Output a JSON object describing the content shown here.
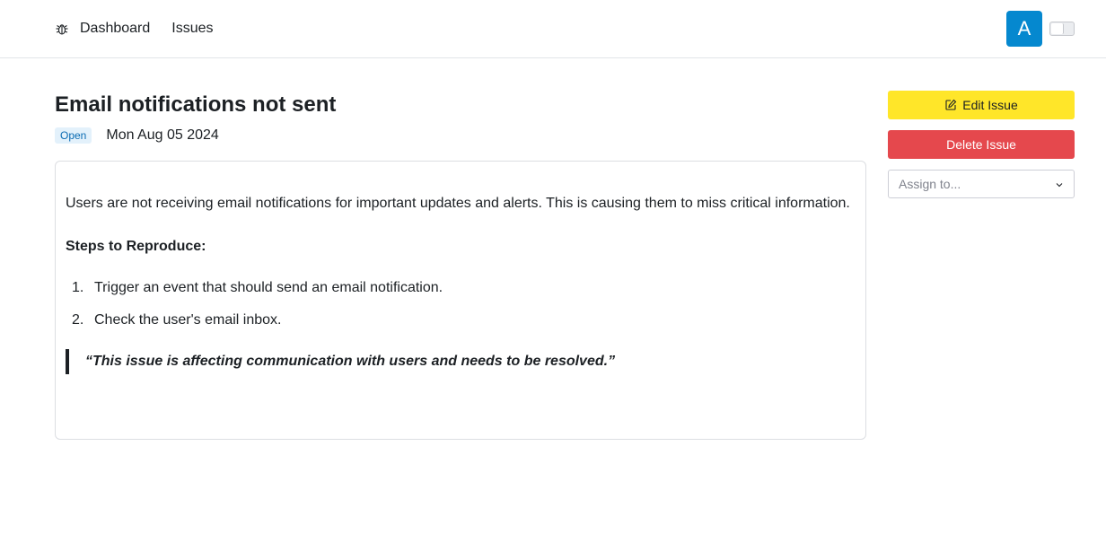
{
  "nav": {
    "logo_icon": "bug-icon",
    "links": [
      "Dashboard",
      "Issues"
    ]
  },
  "user": {
    "avatar_initial": "A"
  },
  "issue": {
    "title": "Email notifications not sent",
    "status": "Open",
    "date": "Mon Aug 05 2024",
    "description": "Users are not receiving email notifications for important updates and alerts. This is causing them to miss critical information.",
    "steps_heading": "Steps to Reproduce:",
    "steps": [
      {
        "num": "1.",
        "text": "Trigger an event that should send an email notification."
      },
      {
        "num": "2.",
        "text": "Check the user's email inbox."
      }
    ],
    "quote": "“This issue is affecting communication with users and needs to be resolved.”"
  },
  "actions": {
    "edit_label": "Edit Issue",
    "delete_label": "Delete Issue",
    "assign_placeholder": "Assign to..."
  },
  "colors": {
    "avatar": "#0588cf",
    "edit_button": "#ffe629",
    "delete_button": "#e5484d",
    "status_badge_bg": "#e3f1fb",
    "status_badge_text": "#0b6cb3"
  }
}
